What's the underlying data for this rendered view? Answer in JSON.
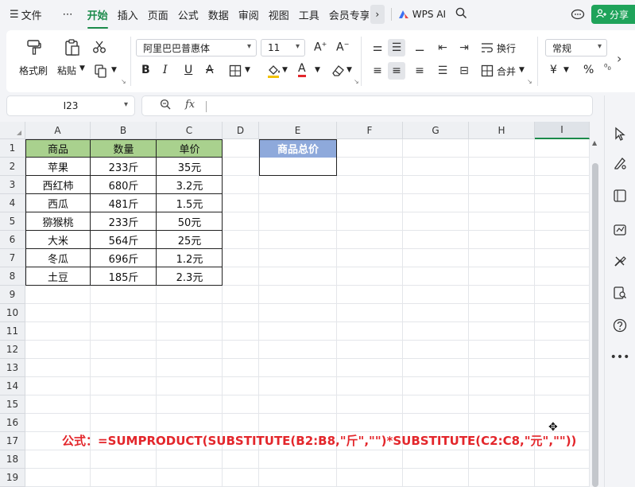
{
  "menu": {
    "hamburger_icon": "menu-icon",
    "file": "文件",
    "more": "⋯",
    "tabs": [
      "开始",
      "插入",
      "页面",
      "公式",
      "数据",
      "审阅",
      "视图",
      "工具",
      "会员专享"
    ],
    "active_tab": "开始",
    "wps_ai": "WPS AI",
    "share": "分享"
  },
  "ribbon": {
    "format_painter": "格式刷",
    "paste": "粘贴",
    "font_name": "阿里巴巴普惠体",
    "font_size": "11",
    "bold": "B",
    "italic": "I",
    "underline": "U",
    "wrap": "换行",
    "merge": "合并",
    "number_format": "常规",
    "currency": "¥",
    "percent": "%"
  },
  "formula_bar": {
    "cell_ref": "I23",
    "fx": "fx",
    "content": ""
  },
  "grid": {
    "columns": [
      "A",
      "B",
      "C",
      "D",
      "E",
      "F",
      "G",
      "H",
      "I"
    ],
    "selected_column": "I",
    "rows": [
      "1",
      "2",
      "3",
      "4",
      "5",
      "6",
      "7",
      "8",
      "9",
      "10",
      "11",
      "12",
      "13",
      "14",
      "15",
      "16",
      "17",
      "18",
      "19"
    ],
    "table_header": [
      "商品",
      "数量",
      "单价"
    ],
    "table_rows": [
      [
        "苹果",
        "233斤",
        "35元"
      ],
      [
        "西红柿",
        "680斤",
        "3.2元"
      ],
      [
        "西瓜",
        "481斤",
        "1.5元"
      ],
      [
        "猕猴桃",
        "233斤",
        "50元"
      ],
      [
        "大米",
        "564斤",
        "25元"
      ],
      [
        "冬瓜",
        "696斤",
        "1.2元"
      ],
      [
        "土豆",
        "185斤",
        "2.3元"
      ]
    ],
    "total_header": "商品总价",
    "total_value": "",
    "header_color": "#a9d18e",
    "total_header_color": "#8ea9db",
    "note": "公式：=SUMPRODUCT(SUBSTITUTE(B2:B8,\"斤\",\"\")*SUBSTITUTE(C2:C8,\"元\",\"\"))",
    "note_color": "#e3262b"
  }
}
